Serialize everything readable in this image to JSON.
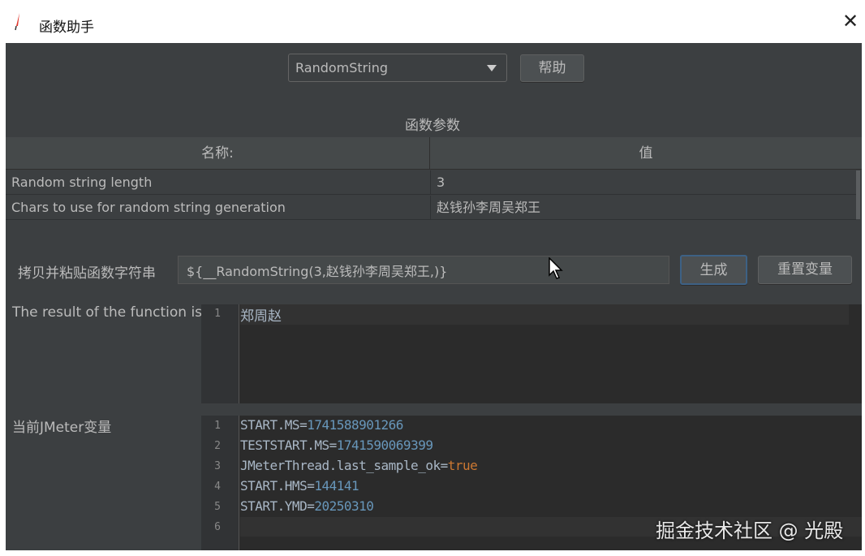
{
  "window": {
    "title": "函数助手",
    "close_label": "X"
  },
  "toolbar": {
    "function_selected": "RandomString",
    "help_label": "帮助"
  },
  "params": {
    "title": "函数参数",
    "headers": [
      "名称:",
      "值"
    ],
    "rows": [
      {
        "name": "Random string length",
        "value": "3"
      },
      {
        "name": "Chars to use for random string generation",
        "value": "赵钱孙李周吴郑王"
      }
    ]
  },
  "copy": {
    "label": "拷贝并粘贴函数字符串",
    "value": "${__RandomString(3,赵钱孙李周吴郑王,)}",
    "generate_label": "生成",
    "reset_label": "重置变量"
  },
  "result": {
    "label": "The result of the function is",
    "lines": [
      {
        "n": "1",
        "text": "郑周赵"
      }
    ]
  },
  "vars": {
    "label": "当前JMeter变量",
    "lines": [
      {
        "n": "1",
        "key": "START.MS=",
        "val": "1741588901266",
        "type": "num"
      },
      {
        "n": "2",
        "key": "TESTSTART.MS=",
        "val": "1741590069399",
        "type": "num"
      },
      {
        "n": "3",
        "key": "JMeterThread.last_sample_ok=",
        "val": "true",
        "type": "kw"
      },
      {
        "n": "4",
        "key": "START.HMS=",
        "val": "144141",
        "type": "num"
      },
      {
        "n": "5",
        "key": "START.YMD=",
        "val": "20250310",
        "type": "num"
      },
      {
        "n": "6",
        "key": "",
        "val": "",
        "type": "num"
      }
    ]
  },
  "watermark": "掘金技术社区 @ 光殿"
}
